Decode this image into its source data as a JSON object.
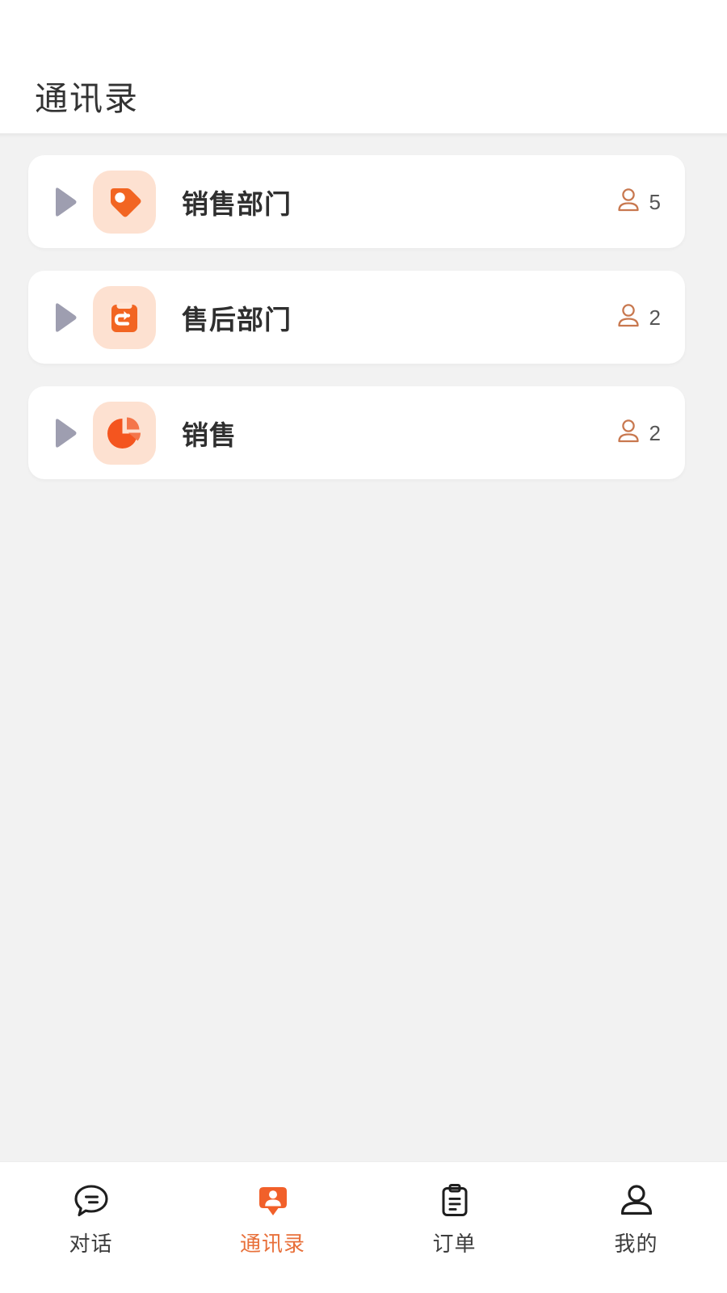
{
  "header": {
    "title": "通讯录"
  },
  "theme": {
    "accent": "#f1602a",
    "accent_soft": "#fde1d1",
    "accent_label": "#e8703a",
    "badge_outline": "#c8784f",
    "arrow": "#9e9eb0",
    "page_bg": "#f2f2f2",
    "card_bg": "#ffffff",
    "text_primary": "#333333",
    "text_secondary": "#565656"
  },
  "departments": [
    {
      "name": "销售部门",
      "member_count": "5",
      "icon": "tag-icon",
      "expand_icon": "play-triangle-icon",
      "member_icon": "person-outline-icon"
    },
    {
      "name": "售后部门",
      "member_count": "2",
      "icon": "clipboard-return-icon",
      "expand_icon": "play-triangle-icon",
      "member_icon": "person-outline-icon"
    },
    {
      "name": "销售",
      "member_count": "2",
      "icon": "pie-chart-icon",
      "expand_icon": "play-triangle-icon",
      "member_icon": "person-outline-icon"
    }
  ],
  "tabbar": {
    "items": [
      {
        "label": "对话",
        "icon": "chat-bubble-icon",
        "active": false
      },
      {
        "label": "通讯录",
        "icon": "contacts-person-badge-icon",
        "active": true
      },
      {
        "label": "订单",
        "icon": "clipboard-list-icon",
        "active": false
      },
      {
        "label": "我的",
        "icon": "person-icon",
        "active": false
      }
    ]
  }
}
